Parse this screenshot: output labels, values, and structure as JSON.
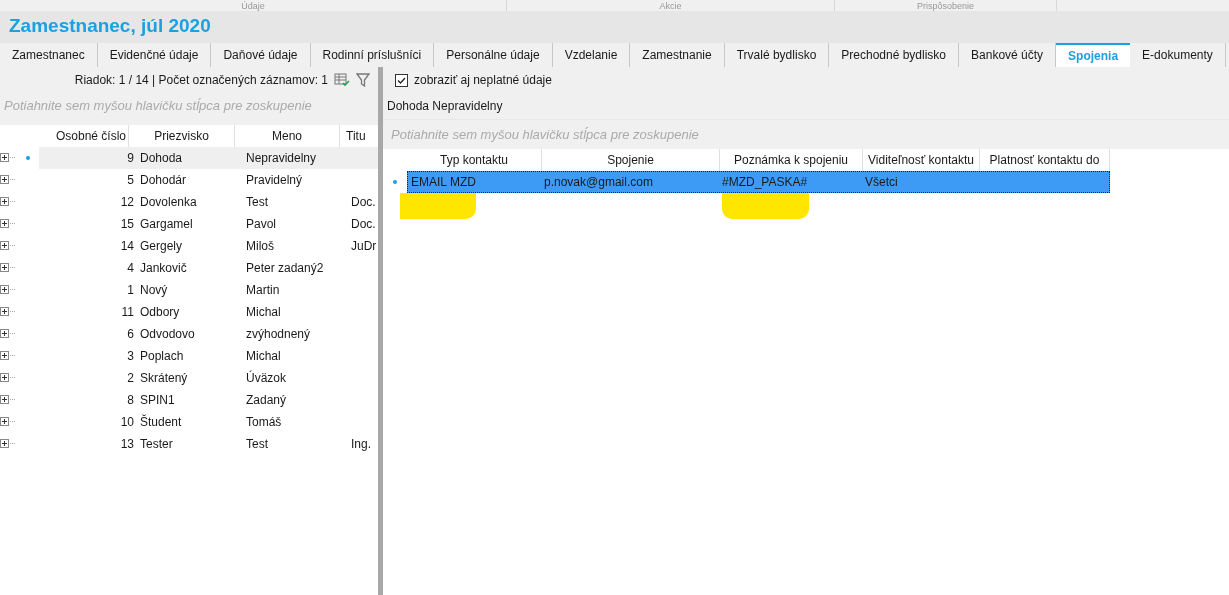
{
  "ribbon_groups": [
    "Údaje",
    "Akcie",
    "Prispôsobenie"
  ],
  "title": "Zamestnanec, júl 2020",
  "tabs": [
    {
      "label": "Zamestnanec",
      "selected": false
    },
    {
      "label": "Evidenčné údaje",
      "selected": false
    },
    {
      "label": "Daňové údaje",
      "selected": false
    },
    {
      "label": "Rodinní príslušníci",
      "selected": false
    },
    {
      "label": "Personálne údaje",
      "selected": false
    },
    {
      "label": "Vzdelanie",
      "selected": false
    },
    {
      "label": "Zamestnanie",
      "selected": false
    },
    {
      "label": "Trvalé bydlisko",
      "selected": false
    },
    {
      "label": "Prechodné bydlisko",
      "selected": false
    },
    {
      "label": "Bankové účty",
      "selected": false
    },
    {
      "label": "Spojenia",
      "selected": true
    },
    {
      "label": "E-dokumenty",
      "selected": false
    }
  ],
  "left": {
    "status": "Riadok: 1 / 14 | Počet označených záznamov: 1",
    "group_hint": "Potiahnite sem myšou hlavičku stĺpca pre zoskupenie",
    "columns": [
      "Osobné číslo",
      "Priezvisko",
      "Meno",
      "Titu"
    ],
    "rows": [
      {
        "cells": [
          "9",
          "Dohoda",
          "Nepravidelny",
          ""
        ],
        "selected": true
      },
      {
        "cells": [
          "5",
          "Dohodár",
          "Pravidelný",
          ""
        ],
        "selected": false
      },
      {
        "cells": [
          "12",
          "Dovolenka",
          "Test",
          "Doc."
        ],
        "selected": false
      },
      {
        "cells": [
          "15",
          "Gargamel",
          "Pavol",
          "Doc."
        ],
        "selected": false
      },
      {
        "cells": [
          "14",
          "Gergely",
          "Miloš",
          "JuDr"
        ],
        "selected": false
      },
      {
        "cells": [
          "4",
          "Jankovič",
          "Peter zadaný2",
          ""
        ],
        "selected": false
      },
      {
        "cells": [
          "1",
          "Nový",
          "Martin",
          ""
        ],
        "selected": false
      },
      {
        "cells": [
          "11",
          "Odbory",
          "Michal",
          ""
        ],
        "selected": false
      },
      {
        "cells": [
          "6",
          "Odvodovo",
          "zvýhodnený",
          ""
        ],
        "selected": false
      },
      {
        "cells": [
          "3",
          "Poplach",
          "Michal",
          ""
        ],
        "selected": false
      },
      {
        "cells": [
          "2",
          "Skrátený",
          "Úväzok",
          ""
        ],
        "selected": false
      },
      {
        "cells": [
          "8",
          "SPIN1",
          "Zadaný",
          ""
        ],
        "selected": false
      },
      {
        "cells": [
          "10",
          "Študent",
          "Tomáš",
          ""
        ],
        "selected": false
      },
      {
        "cells": [
          "13",
          "Tester",
          "Test",
          "Ing."
        ],
        "selected": false
      }
    ]
  },
  "right": {
    "show_invalid": {
      "label": "zobraziť aj neplatné údaje",
      "checked": true
    },
    "employee": "Dohoda Nepravidelny",
    "group_hint": "Potiahnite sem myšou hlavičku stĺpca pre zoskupenie",
    "columns": [
      "Typ kontaktu",
      "Spojenie",
      "Poznámka k spojeniu",
      "Viditeľnosť kontaktu",
      "Platnosť kontaktu do"
    ],
    "rows": [
      {
        "cells": [
          "EMAIL MZD",
          "p.novak@gmail.com",
          "#MZD_PASKA#",
          "Všetci",
          ""
        ],
        "selected": true
      }
    ]
  }
}
